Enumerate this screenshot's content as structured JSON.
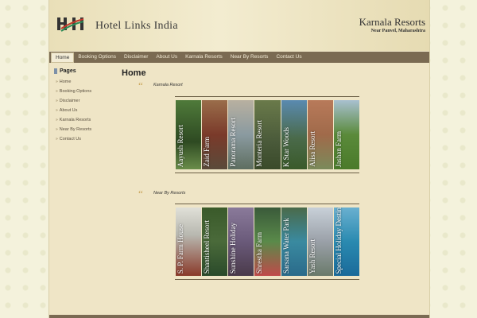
{
  "header": {
    "logo_text": "Hotel Links India",
    "site_title": "Karnala Resorts",
    "site_subtitle": "Near Panvel, Maharashtra"
  },
  "nav": {
    "items": [
      {
        "label": "Home",
        "active": true
      },
      {
        "label": "Booking Options"
      },
      {
        "label": "Disclaimer"
      },
      {
        "label": "About Us"
      },
      {
        "label": "Karnala Resorts"
      },
      {
        "label": "Near By Resorts"
      },
      {
        "label": "Contact Us"
      }
    ]
  },
  "sidebar": {
    "title": "Pages",
    "links": [
      "Home",
      "Booking Options",
      "Disclaimer",
      "About Us",
      "Karnala Resorts",
      "Near By Resorts",
      "Contact Us"
    ]
  },
  "main": {
    "title": "Home",
    "sections": [
      {
        "label": "Karnala Resort",
        "thumbs": [
          "Aayush Resort",
          "Zaid Farm",
          "Panorama Resort",
          "Monteria Resort",
          "K Star Woods",
          "Alisa Resort",
          "Jashan Farm"
        ]
      },
      {
        "label": "Near By Resorts",
        "thumbs": [
          "S. P. Farm House",
          "Shantisheel Resort",
          "Sunshine Holiday",
          "Shrestha Farm",
          "Sarsana Water Park",
          "Yash Resort",
          "Special Holiday Destination"
        ]
      }
    ]
  },
  "colors": {
    "nav_bg": "#7a6a52",
    "page_bg": "#efe5c6",
    "quote_accent": "#c9a55a"
  }
}
